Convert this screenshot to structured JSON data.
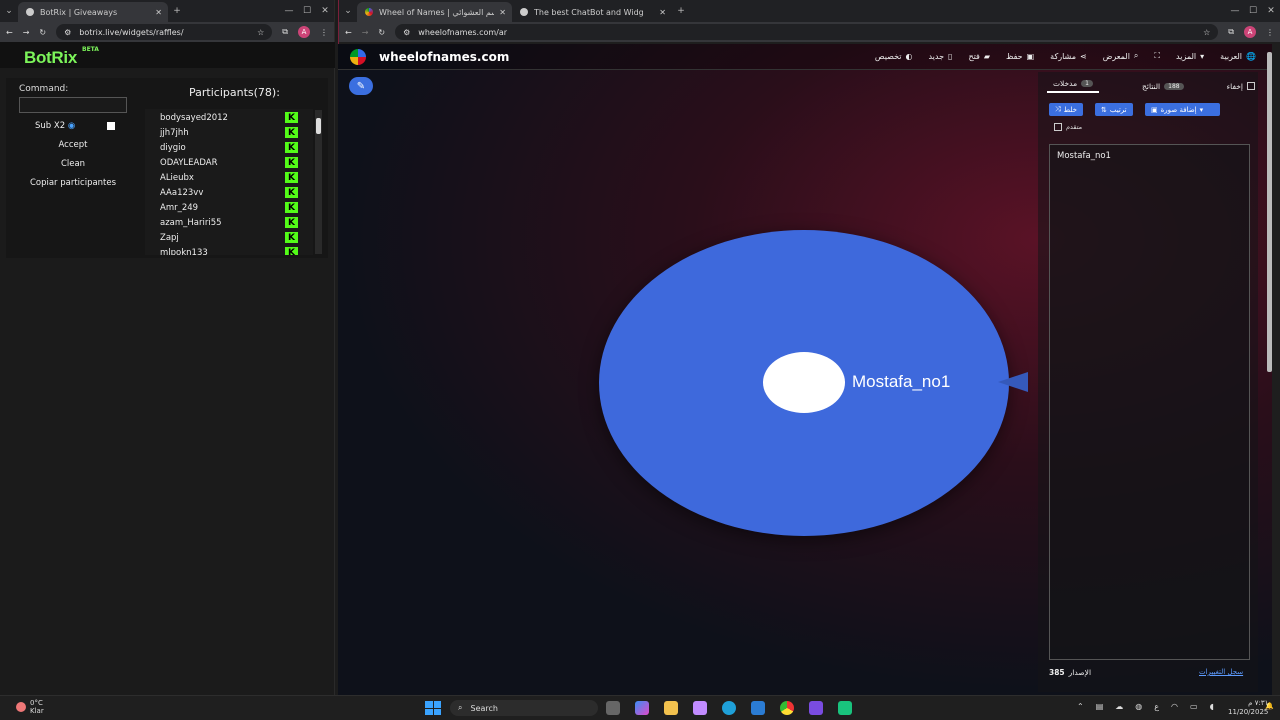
{
  "left_window": {
    "tab_title": "BotRix | Giveaways",
    "url": "botrix.live/widgets/raffles/",
    "logo": "BotRix",
    "beta": "BETA",
    "command_label": "Command:",
    "sub_label": "Sub X2",
    "accept": "Accept",
    "clean": "Clean",
    "copy": "Copiar participantes",
    "participants_title": "Participants(78):",
    "participants": [
      "bodysayed2012",
      "jjh7jhh",
      "diygio",
      "ODAYLEADAR",
      "ALieubx",
      "AAa123vv",
      "Amr_249",
      "azam_Hariri55",
      "Zapj",
      "mlpokn133"
    ]
  },
  "right_window": {
    "tabs": [
      "Wheel of Names | عجلة الإسم العشوائي",
      "The best ChatBot and Widgets"
    ],
    "url": "wheelofnames.com/ar",
    "site_name": "wheelofnames.com",
    "toolbar": [
      "تخصيص",
      "جديد",
      "فتح",
      "حفظ",
      "مشاركة",
      "المعرض",
      "المزيد",
      "العربية"
    ],
    "panel_tabs": {
      "entries": "مدخلات",
      "entries_count": "1",
      "results": "النتائج",
      "results_count": "188",
      "hide": "إخفاء"
    },
    "buttons": {
      "shuffle": "خلط",
      "sort": "ترتيب",
      "add_image": "إضافة صورة"
    },
    "advanced": "متقدم",
    "entries_text": "Mostafa_no1",
    "wheel_label": "Mostafa_no1",
    "version_label": "الإصدار",
    "version": "385",
    "changelog": "سجل التغييرات",
    "wheel_color": "#3e69dc"
  },
  "taskbar": {
    "weather_temp": "0°C",
    "weather_desc": "Klar",
    "search": "Search",
    "time": "٧:٣١ م",
    "date": "11/20/2025",
    "lang": "ع"
  }
}
